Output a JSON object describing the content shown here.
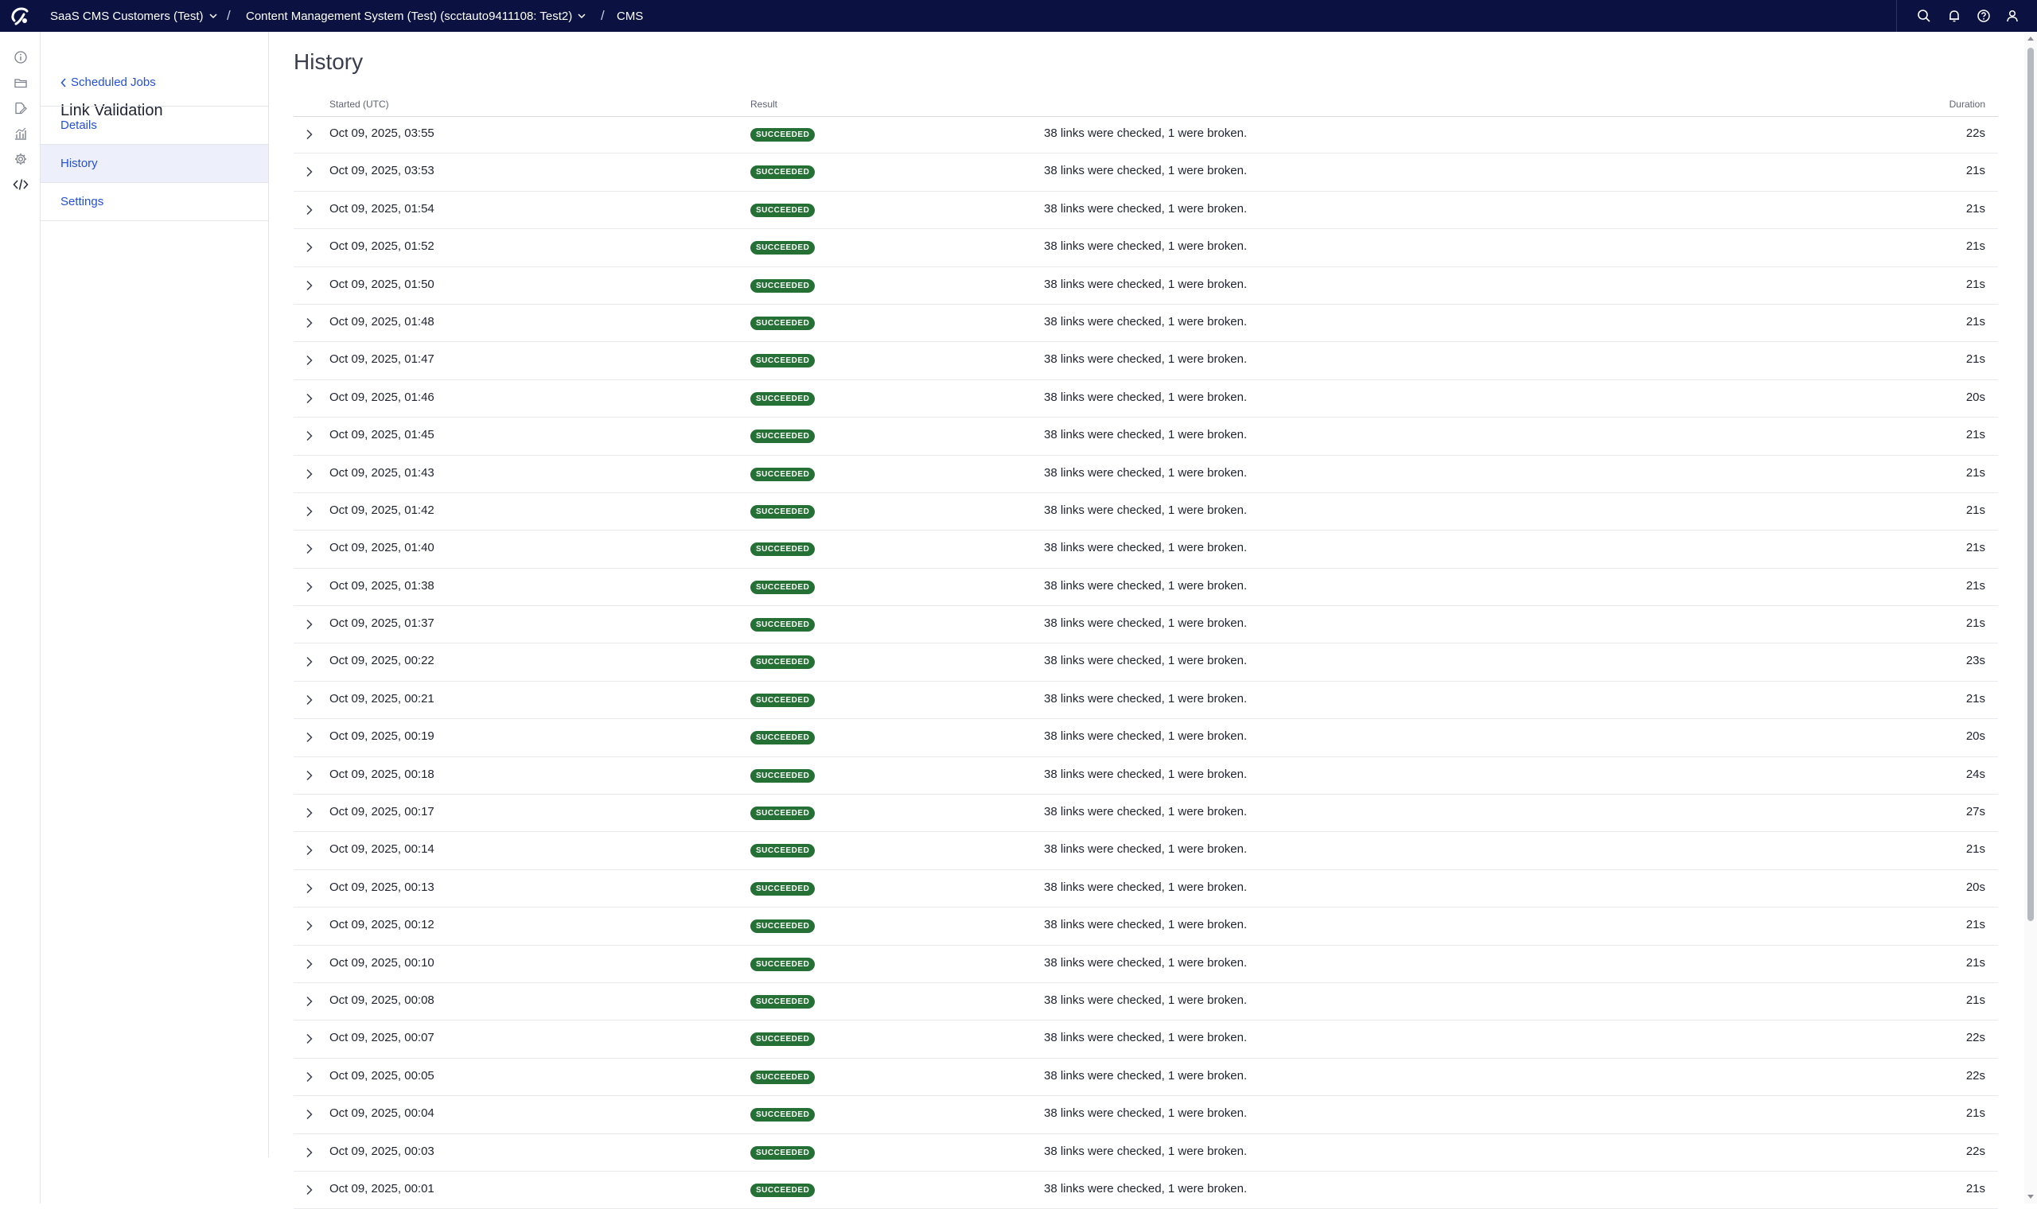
{
  "topbar": {
    "breadcrumbs": [
      {
        "label": "SaaS CMS Customers (Test)"
      },
      {
        "label": "Content Management System (Test) (scctauto9411108: Test2)"
      },
      {
        "label": "CMS"
      }
    ],
    "icons": [
      "search-icon",
      "bell-icon",
      "help-icon",
      "user-icon"
    ]
  },
  "rail": {
    "icons": [
      "info-icon",
      "folder-icon",
      "edit-icon",
      "chart-icon",
      "gear-icon",
      "code-icon"
    ]
  },
  "subnav": {
    "back_label": "Scheduled Jobs",
    "title": "Link Validation",
    "items": [
      {
        "label": "Details"
      },
      {
        "label": "History"
      },
      {
        "label": "Settings"
      }
    ],
    "active_item": "History"
  },
  "main": {
    "title": "History",
    "columns": {
      "started": "Started (UTC)",
      "result": "Result",
      "duration": "Duration"
    },
    "rows": [
      {
        "started": "Oct 09, 2025, 03:55",
        "status": "SUCCEEDED",
        "message": "38 links were checked, 1 were broken.",
        "duration": "22s"
      },
      {
        "started": "Oct 09, 2025, 03:53",
        "status": "SUCCEEDED",
        "message": "38 links were checked, 1 were broken.",
        "duration": "21s"
      },
      {
        "started": "Oct 09, 2025, 01:54",
        "status": "SUCCEEDED",
        "message": "38 links were checked, 1 were broken.",
        "duration": "21s"
      },
      {
        "started": "Oct 09, 2025, 01:52",
        "status": "SUCCEEDED",
        "message": "38 links were checked, 1 were broken.",
        "duration": "21s"
      },
      {
        "started": "Oct 09, 2025, 01:50",
        "status": "SUCCEEDED",
        "message": "38 links were checked, 1 were broken.",
        "duration": "21s"
      },
      {
        "started": "Oct 09, 2025, 01:48",
        "status": "SUCCEEDED",
        "message": "38 links were checked, 1 were broken.",
        "duration": "21s"
      },
      {
        "started": "Oct 09, 2025, 01:47",
        "status": "SUCCEEDED",
        "message": "38 links were checked, 1 were broken.",
        "duration": "21s"
      },
      {
        "started": "Oct 09, 2025, 01:46",
        "status": "SUCCEEDED",
        "message": "38 links were checked, 1 were broken.",
        "duration": "20s"
      },
      {
        "started": "Oct 09, 2025, 01:45",
        "status": "SUCCEEDED",
        "message": "38 links were checked, 1 were broken.",
        "duration": "21s"
      },
      {
        "started": "Oct 09, 2025, 01:43",
        "status": "SUCCEEDED",
        "message": "38 links were checked, 1 were broken.",
        "duration": "21s"
      },
      {
        "started": "Oct 09, 2025, 01:42",
        "status": "SUCCEEDED",
        "message": "38 links were checked, 1 were broken.",
        "duration": "21s"
      },
      {
        "started": "Oct 09, 2025, 01:40",
        "status": "SUCCEEDED",
        "message": "38 links were checked, 1 were broken.",
        "duration": "21s"
      },
      {
        "started": "Oct 09, 2025, 01:38",
        "status": "SUCCEEDED",
        "message": "38 links were checked, 1 were broken.",
        "duration": "21s"
      },
      {
        "started": "Oct 09, 2025, 01:37",
        "status": "SUCCEEDED",
        "message": "38 links were checked, 1 were broken.",
        "duration": "21s"
      },
      {
        "started": "Oct 09, 2025, 00:22",
        "status": "SUCCEEDED",
        "message": "38 links were checked, 1 were broken.",
        "duration": "23s"
      },
      {
        "started": "Oct 09, 2025, 00:21",
        "status": "SUCCEEDED",
        "message": "38 links were checked, 1 were broken.",
        "duration": "21s"
      },
      {
        "started": "Oct 09, 2025, 00:19",
        "status": "SUCCEEDED",
        "message": "38 links were checked, 1 were broken.",
        "duration": "20s"
      },
      {
        "started": "Oct 09, 2025, 00:18",
        "status": "SUCCEEDED",
        "message": "38 links were checked, 1 were broken.",
        "duration": "24s"
      },
      {
        "started": "Oct 09, 2025, 00:17",
        "status": "SUCCEEDED",
        "message": "38 links were checked, 1 were broken.",
        "duration": "27s"
      },
      {
        "started": "Oct 09, 2025, 00:14",
        "status": "SUCCEEDED",
        "message": "38 links were checked, 1 were broken.",
        "duration": "21s"
      },
      {
        "started": "Oct 09, 2025, 00:13",
        "status": "SUCCEEDED",
        "message": "38 links were checked, 1 were broken.",
        "duration": "20s"
      },
      {
        "started": "Oct 09, 2025, 00:12",
        "status": "SUCCEEDED",
        "message": "38 links were checked, 1 were broken.",
        "duration": "21s"
      },
      {
        "started": "Oct 09, 2025, 00:10",
        "status": "SUCCEEDED",
        "message": "38 links were checked, 1 were broken.",
        "duration": "21s"
      },
      {
        "started": "Oct 09, 2025, 00:08",
        "status": "SUCCEEDED",
        "message": "38 links were checked, 1 were broken.",
        "duration": "21s"
      },
      {
        "started": "Oct 09, 2025, 00:07",
        "status": "SUCCEEDED",
        "message": "38 links were checked, 1 were broken.",
        "duration": "22s"
      },
      {
        "started": "Oct 09, 2025, 00:05",
        "status": "SUCCEEDED",
        "message": "38 links were checked, 1 were broken.",
        "duration": "22s"
      },
      {
        "started": "Oct 09, 2025, 00:04",
        "status": "SUCCEEDED",
        "message": "38 links were checked, 1 were broken.",
        "duration": "21s"
      },
      {
        "started": "Oct 09, 2025, 00:03",
        "status": "SUCCEEDED",
        "message": "38 links were checked, 1 were broken.",
        "duration": "22s"
      },
      {
        "started": "Oct 09, 2025, 00:01",
        "status": "SUCCEEDED",
        "message": "38 links were checked, 1 were broken.",
        "duration": "21s"
      }
    ]
  },
  "colors": {
    "topbar_bg": "#0b1140",
    "link": "#2450d8",
    "success_badge": "#257034",
    "active_nav_bg": "#edf0fb"
  }
}
